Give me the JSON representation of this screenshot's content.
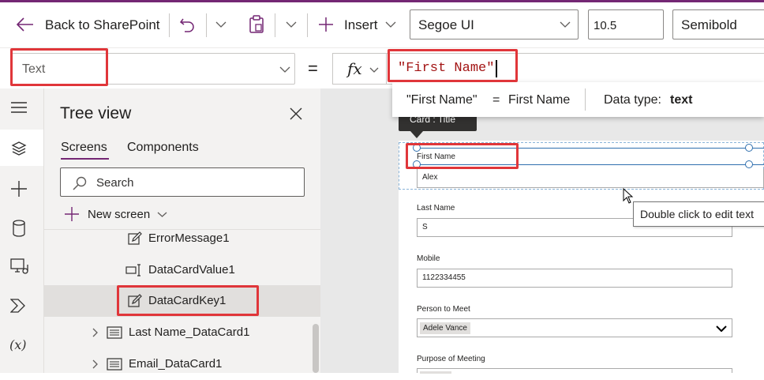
{
  "toolbar": {
    "back_label": "Back to SharePoint",
    "insert_label": "Insert",
    "font_family": "Segoe UI",
    "font_size": "10.5",
    "font_weight": "Semibold"
  },
  "formula_bar": {
    "property": "Text",
    "equals": "=",
    "fx": "fx",
    "formula": "\"First Name\"",
    "preview_expression": "\"First Name\"",
    "preview_equals": "=",
    "preview_result": "First Name",
    "data_type_label": "Data type:",
    "data_type_value": "text"
  },
  "tree_view": {
    "title": "Tree view",
    "tabs": [
      "Screens",
      "Components"
    ],
    "search_placeholder": "Search",
    "new_screen_label": "New screen",
    "items": [
      {
        "label": "ErrorMessage1",
        "icon": "edit-icon"
      },
      {
        "label": "DataCardValue1",
        "icon": "textinput-icon"
      },
      {
        "label": "DataCardKey1",
        "icon": "edit-icon",
        "selected": true
      },
      {
        "label": "Last Name_DataCard1",
        "icon": "card-icon"
      },
      {
        "label": "Email_DataCard1",
        "icon": "card-icon"
      }
    ]
  },
  "canvas": {
    "card_tooltip": "Card : Title",
    "edit_tooltip": "Double click to edit text",
    "fields": [
      {
        "label": "First Name",
        "value": "Alex"
      },
      {
        "label": "Last Name",
        "value": "S"
      },
      {
        "label": "Mobile",
        "value": "1122334455"
      },
      {
        "label": "Person to Meet",
        "value": "Adele Vance"
      },
      {
        "label": "Purpose of Meeting",
        "value": ""
      }
    ]
  },
  "colors": {
    "accent": "#742774",
    "highlight": "#e0363a",
    "formula_text": "#a31515"
  }
}
